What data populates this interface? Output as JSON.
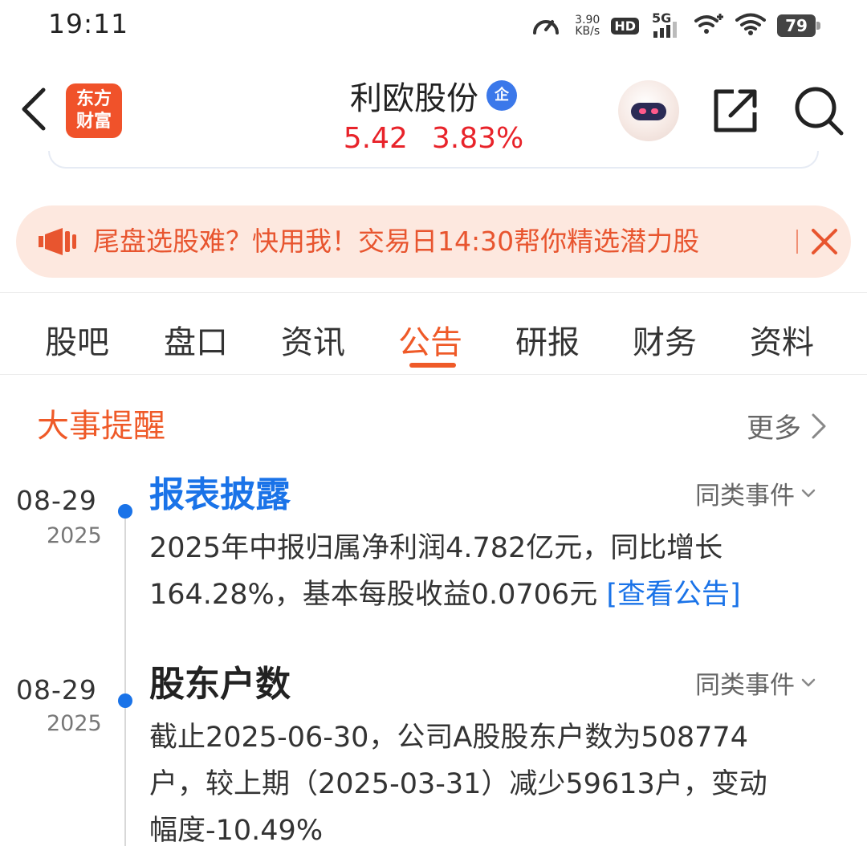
{
  "status_bar": {
    "time": "19:11",
    "net_speed_value": "3.90",
    "net_speed_unit": "KB/s",
    "hd_label": "HD",
    "network_label": "5G",
    "battery_level": "79",
    "icons": [
      "speedometer-icon",
      "hd-icon",
      "5g-signal-icon",
      "wifi-plus-icon",
      "wifi-icon",
      "battery-icon"
    ]
  },
  "header": {
    "logo_line1": "东方",
    "logo_line2": "财富",
    "stock_name": "利欧股份",
    "verified_badge": "企",
    "price": "5.42",
    "change_pct": "3.83%",
    "price_color": "#e8232a"
  },
  "promo": {
    "text": "尾盘选股难？快用我！交易日14:30帮你精选潜力股"
  },
  "tabs": {
    "items": [
      {
        "label": "股吧",
        "active": false
      },
      {
        "label": "盘口",
        "active": false
      },
      {
        "label": "资讯",
        "active": false
      },
      {
        "label": "公告",
        "active": true
      },
      {
        "label": "研报",
        "active": false
      },
      {
        "label": "财务",
        "active": false
      },
      {
        "label": "资料",
        "active": false
      }
    ],
    "accent": "#ef5a28"
  },
  "events": {
    "section_title": "大事提醒",
    "more_label": "更多",
    "items": [
      {
        "date": "08-29",
        "year": "2025",
        "title": "报表披露",
        "similar_label": "同类事件",
        "desc_line1": "2025年中报归属净利润4.782亿元，同比增长",
        "desc_line2": "164.28%，基本每股收益0.0706元 ",
        "link_text": "[查看公告]"
      },
      {
        "date": "08-29",
        "year": "2025",
        "title": "股东户数",
        "similar_label": "同类事件",
        "desc_line1": "截止2025-06-30，公司A股股东户数为508774",
        "desc_line2": "户，较上期（2025-03-31）减少59613户，变动",
        "desc_line3": "幅度-10.49%"
      }
    ],
    "dot_color": "#1a73e8",
    "title_blue": "#1a73e8"
  }
}
